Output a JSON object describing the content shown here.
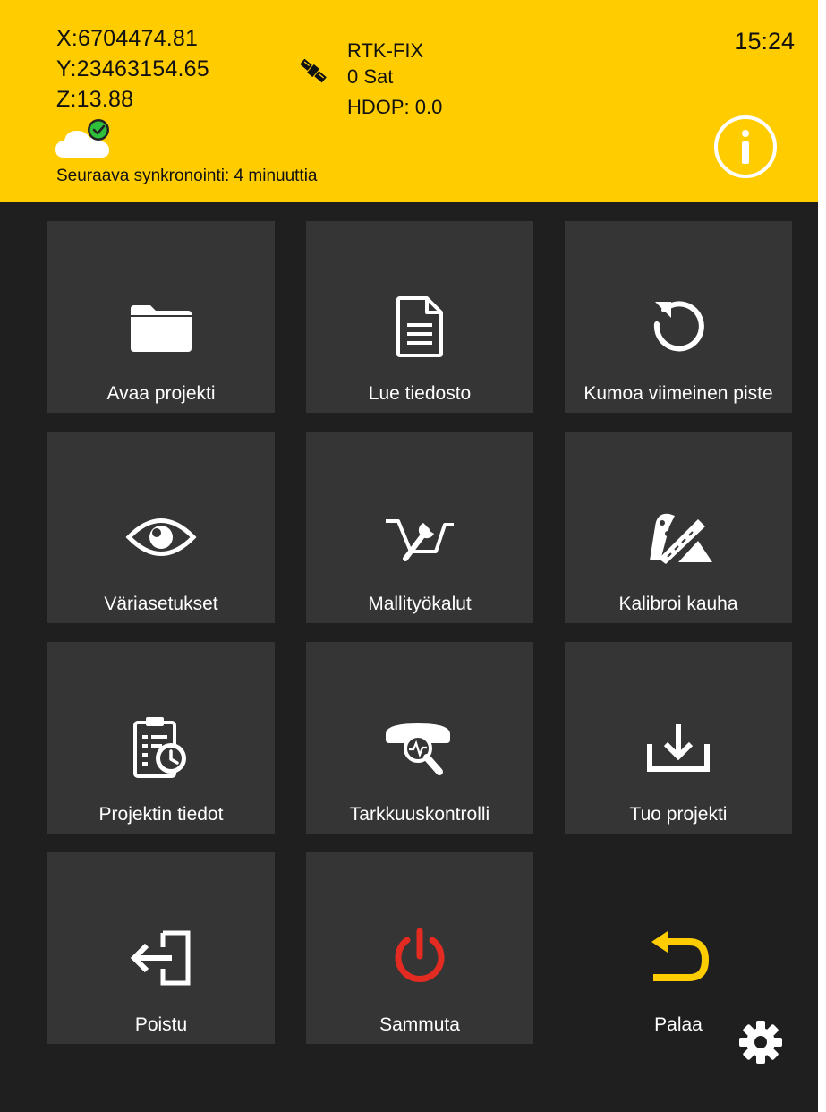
{
  "header": {
    "x": "X:6704474.81",
    "y": "Y:23463154.65",
    "z": "Z:13.88",
    "fix": "RTK-FIX",
    "satellites": "0 Sat",
    "hdop": "HDOP: 0.0",
    "sync": "Seuraava synkronointi: 4 minuuttia",
    "time": "15:24",
    "cloud_icon": "cloud-check-icon",
    "satellite_icon": "satellite-icon",
    "info_icon": "info-icon"
  },
  "tiles": [
    {
      "label": "Avaa projekti",
      "icon": "folder-icon"
    },
    {
      "label": "Lue tiedosto",
      "icon": "document-icon"
    },
    {
      "label": "Kumoa viimeinen piste",
      "icon": "undo-icon"
    },
    {
      "label": "Väriasetukset",
      "icon": "eye-icon"
    },
    {
      "label": "Mallityökalut",
      "icon": "model-tools-icon"
    },
    {
      "label": "Kalibroi kauha",
      "icon": "bucket-calibrate-icon"
    },
    {
      "label": "Projektin tiedot",
      "icon": "clipboard-clock-icon"
    },
    {
      "label": "Tarkkuuskontrolli",
      "icon": "accuracy-check-icon"
    },
    {
      "label": "Tuo projekti",
      "icon": "import-icon"
    },
    {
      "label": "Poistu",
      "icon": "exit-icon"
    },
    {
      "label": "Sammuta",
      "icon": "power-icon"
    },
    {
      "label": "Palaa",
      "icon": "return-icon"
    }
  ],
  "footer": {
    "settings_icon": "gear-icon"
  },
  "colors": {
    "header": "#ffcc00",
    "background": "#1f1f1f",
    "tile": "#353535",
    "power": "#e32b22",
    "return": "#ffcc00",
    "sync_ok": "#2fbf3a"
  }
}
